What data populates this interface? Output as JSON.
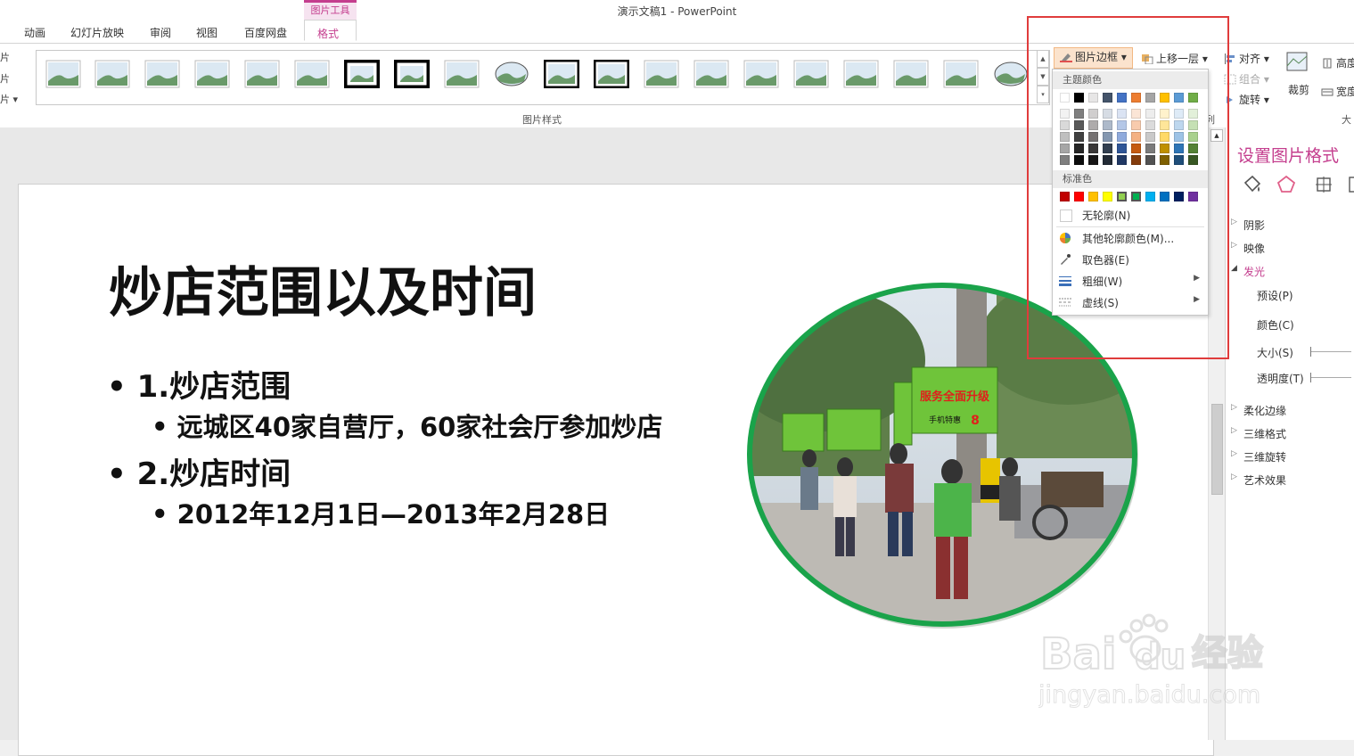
{
  "window": {
    "title": "演示文稿1 - PowerPoint"
  },
  "tabs": {
    "context_group": "图片工具",
    "items": [
      "动画",
      "幻灯片放映",
      "审阅",
      "视图",
      "百度网盘",
      "格式"
    ],
    "active": "格式"
  },
  "ribbon": {
    "left_truncated": [
      "片",
      "片",
      "片 ▾"
    ],
    "gallery_label": "图片样式",
    "border_button": "图片边框",
    "bring_forward": "上移一层",
    "align": "对齐",
    "group": "组合",
    "rotate": "旋转",
    "arrange_label_truncated": "列",
    "crop": "裁剪",
    "height": "高度",
    "width": "宽度",
    "size_label_truncated": "大"
  },
  "border_menu": {
    "theme_colors_header": "主题颜色",
    "standard_colors_header": "标准色",
    "no_outline": "无轮廓(N)",
    "more_colors": "其他轮廓颜色(M)...",
    "eyedropper": "取色器(E)",
    "weight": "粗细(W)",
    "dashes": "虚线(S)",
    "theme_top_row": [
      "#ffffff",
      "#000000",
      "#e7e6e6",
      "#44546a",
      "#4472c4",
      "#ed7d31",
      "#a5a5a5",
      "#ffc000",
      "#5b9bd5",
      "#70ad47"
    ],
    "theme_shades": [
      [
        "#f2f2f2",
        "#7f7f7f",
        "#d0cece",
        "#d6dce4",
        "#dae3f3",
        "#fbe5d6",
        "#ededed",
        "#fff2cc",
        "#deebf7",
        "#e2f0d9"
      ],
      [
        "#d9d9d9",
        "#595959",
        "#aeabab",
        "#adb9ca",
        "#b4c7e7",
        "#f8cbad",
        "#dbdbdb",
        "#ffe699",
        "#bdd7ee",
        "#c5e0b4"
      ],
      [
        "#bfbfbf",
        "#404040",
        "#757171",
        "#8497b0",
        "#8faadc",
        "#f4b183",
        "#c9c9c9",
        "#ffd966",
        "#9dc3e6",
        "#a9d18e"
      ],
      [
        "#a6a6a6",
        "#262626",
        "#3a3838",
        "#333f50",
        "#2f5597",
        "#c55a11",
        "#7b7b7b",
        "#bf9000",
        "#2e75b6",
        "#548235"
      ],
      [
        "#7f7f7f",
        "#0d0d0d",
        "#171616",
        "#222a35",
        "#203864",
        "#843c0c",
        "#525252",
        "#7f6000",
        "#1f4e79",
        "#385723"
      ]
    ],
    "standard": [
      "#c00000",
      "#ff0000",
      "#ffc000",
      "#ffff00",
      "#92d050",
      "#00b050",
      "#00b0f0",
      "#0070c0",
      "#002060",
      "#7030a0"
    ]
  },
  "slide": {
    "title": "炒店范围以及时间",
    "bullets": [
      {
        "level": 1,
        "text": "1.炒店范围"
      },
      {
        "level": 2,
        "text": "远城区40家自营厅，60家社会厅参加炒店"
      },
      {
        "level": 1,
        "text": "2.炒店时间"
      },
      {
        "level": 2,
        "text": "2012年12月1日—2013年2月28日"
      }
    ],
    "photo": {
      "sign1": "服务全面升级",
      "sign2": "手机特惠",
      "sign3": "8",
      "border_color": "#1aa34a"
    }
  },
  "pane": {
    "title": "设置图片格式",
    "sections": [
      "阴影",
      "映像",
      "发光",
      "柔化边缘",
      "三维格式",
      "三维旋转",
      "艺术效果"
    ],
    "expanded": "发光",
    "glow_rows": [
      "预设(P)",
      "颜色(C)",
      "大小(S)",
      "透明度(T)"
    ]
  },
  "watermark": {
    "brand": "Bai",
    "brand2": "du",
    "product": "经验",
    "url": "jingyan.baidu.com"
  },
  "colors": {
    "accent": "#c43e8e",
    "highlight": "#e03c3c",
    "button_hover": "#fbe3cd"
  }
}
